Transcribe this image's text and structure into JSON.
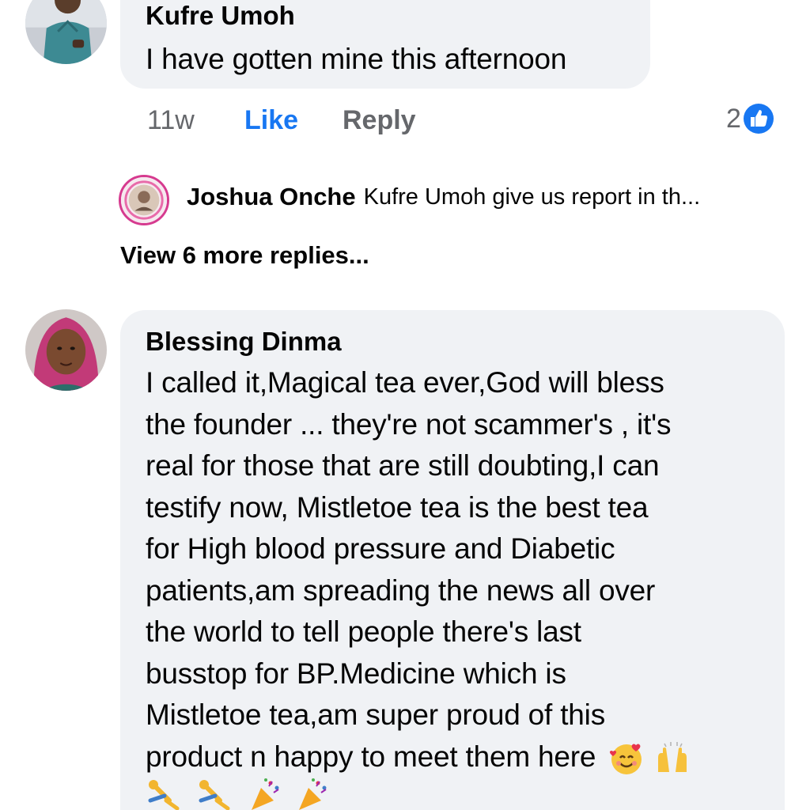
{
  "comments": [
    {
      "author": "Kufre Umoh",
      "text": "I have gotten mine this afternoon",
      "time": "11w",
      "like_label": "Like",
      "reply_label": "Reply",
      "reaction_count": "2",
      "reaction_icon": "like-thumb-icon"
    },
    {
      "author": "Blessing Dinma",
      "text_lines": [
        "I called it,Magical tea ever,God will bless",
        "the founder ... they're not scammer's , it's",
        "real for those that are still doubting,I can",
        "testify now, Mistletoe tea is the best tea",
        "for High blood pressure and Diabetic",
        "patients,am spreading the news all over",
        "the world to tell people there's last",
        "busstop for BP.Medicine which is",
        "Mistletoe tea,am super proud of this",
        "product n happy to meet them here"
      ],
      "emojis": [
        "smiling-face-with-hearts-icon",
        "raising-hands-icon",
        "cartwheel-icon",
        "cartwheel-icon",
        "party-popper-icon",
        "party-popper-icon"
      ]
    }
  ],
  "reply_preview": {
    "author": "Joshua Onche",
    "text": "Kufre Umoh give us report in th..."
  },
  "view_more_label": "View 6 more replies...",
  "colors": {
    "bubble": "#f0f2f5",
    "like_blue": "#1877f2",
    "muted": "#65676b"
  }
}
